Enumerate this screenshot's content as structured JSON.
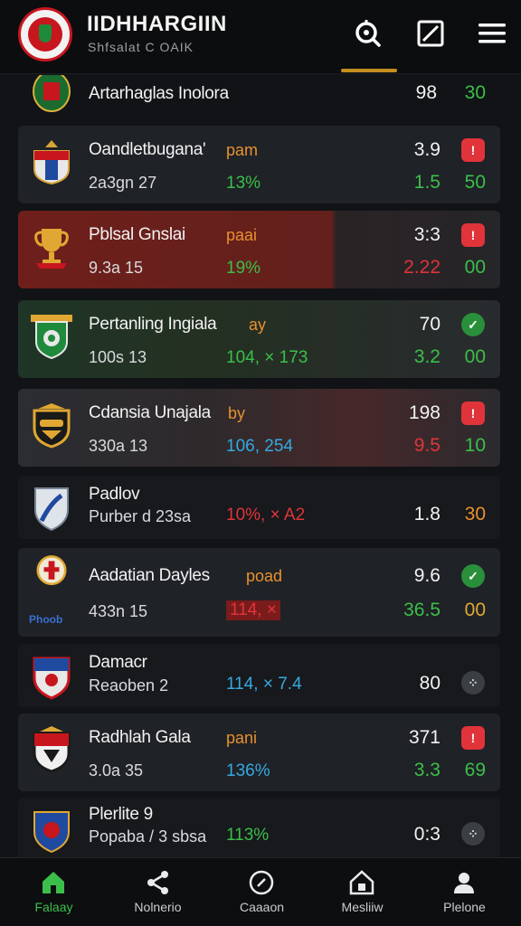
{
  "app": {
    "title": "IIDHHARGIIN",
    "subtitle": "Shfsalat C OAIK"
  },
  "header_icons": [
    "search-icon",
    "edit-icon",
    "menu-icon"
  ],
  "colors": {
    "accent": "#c48f1e",
    "green": "#3bbf4a",
    "red": "#e0343a",
    "orange": "#e7912f",
    "cyan": "#36a9e1"
  },
  "matches": [
    {
      "name": "Artarhaglas Inolora",
      "v1": "98",
      "v3": "30"
    },
    {
      "name": "Oandletbugana'",
      "tag": "pam",
      "line2": "2a3gn 27",
      "pct": "13%",
      "v1": "3.9",
      "v2": "1.5",
      "v3": "50",
      "badge": "!"
    },
    {
      "name": "Pblsal Gnslai",
      "tag": "paai",
      "line2": "9.3a 15",
      "pct": "19%",
      "v1": "3:3",
      "v2": "2.22",
      "v3": "00",
      "badge": "!"
    },
    {
      "name": "Pertanling Ingiala",
      "tag": "ay",
      "line2": "100s 13",
      "pct": "104, × 173",
      "v1": "70",
      "v2": "3.2",
      "v3": "00",
      "badge": "✓"
    },
    {
      "name": "Cdansia Unajala",
      "tag": "by",
      "line2": "330a 13",
      "pct": "106, 254",
      "v1": "198",
      "v2": "9.5",
      "v3": "10",
      "badge": "!"
    },
    {
      "name": "Padlov",
      "line2": "Purber d 23sa",
      "pct": "10%, × A2",
      "v1": "1.8",
      "v3": "30"
    },
    {
      "name": "Aadatian Dayles",
      "tag": "poad",
      "line2": "433n 15",
      "pct": "114, ×",
      "v1": "9.6",
      "v2": "36.5",
      "v3": "00",
      "badge": "✓",
      "crest_text": "Phoob"
    },
    {
      "name": "Damacr",
      "line2": "Reaoben 2",
      "pct": "114, × 7.4",
      "v1": "80",
      "badge": "⁘"
    },
    {
      "name": "Radhlah Gala",
      "tag": "pani",
      "line2": "3.0a 35",
      "pct": "136%",
      "v1": "371",
      "v2": "3.3",
      "v3": "69",
      "badge": "!"
    },
    {
      "name": "Plerlite 9",
      "line2": "Popaba / 3 sbsa",
      "pct": "113%",
      "v1": "0:3",
      "badge": "⁘"
    }
  ],
  "nav": [
    {
      "label": "Falaay",
      "icon": "home-icon",
      "active": true
    },
    {
      "label": "Nolnerio",
      "icon": "share-icon",
      "active": false
    },
    {
      "label": "Caaaon",
      "icon": "compass-icon",
      "active": false
    },
    {
      "label": "Mesliiw",
      "icon": "house-icon",
      "active": false
    },
    {
      "label": "Plelone",
      "icon": "profile-icon",
      "active": false
    }
  ]
}
